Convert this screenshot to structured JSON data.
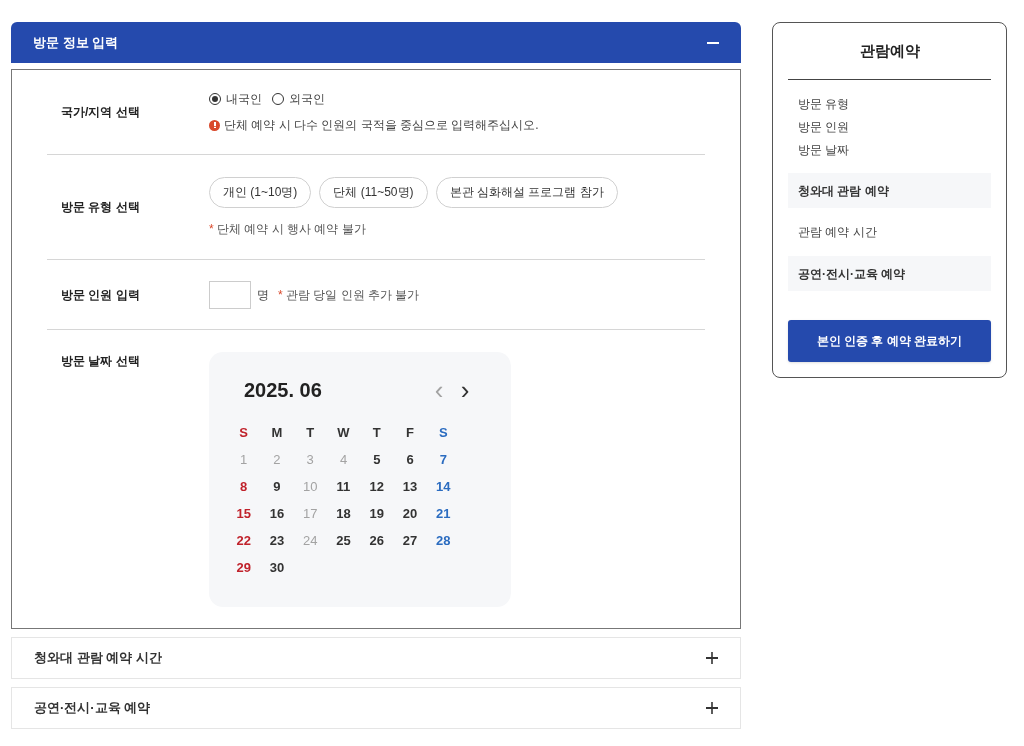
{
  "sections": [
    {
      "title": "방문 정보 입력",
      "expanded": true
    },
    {
      "title": "청와대 관람 예약 시간",
      "expanded": false
    },
    {
      "title": "공연·전시·교육 예약",
      "expanded": false
    }
  ],
  "nationality": {
    "label": "국가/지역 선택",
    "options": [
      {
        "label": "내국인",
        "selected": true
      },
      {
        "label": "외국인",
        "selected": false
      }
    ],
    "notice": "단체 예약 시 다수 인원의 국적을 중심으로 입력해주십시오."
  },
  "visit_type": {
    "label": "방문 유형 선택",
    "options": [
      {
        "label": "개인 (1~10명)",
        "selected": false
      },
      {
        "label": "단체 (11~50명)",
        "selected": false
      },
      {
        "label": "본관 심화해설 프로그램 참가",
        "selected": false
      }
    ],
    "note": "단체 예약 시 행사 예약 불가",
    "note_mark": "*"
  },
  "visitors": {
    "label": "방문 인원 입력",
    "unit": "명",
    "note": "관람 당일 인원 추가 불가",
    "note_mark": "*"
  },
  "date": {
    "label": "방문 날짜 선택",
    "calendar": {
      "month": "2025. 06",
      "prev": {
        "symbol": "‹",
        "disabled": true
      },
      "next": {
        "symbol": "›",
        "disabled": false
      },
      "weekdays": [
        "S",
        "M",
        "T",
        "W",
        "T",
        "F",
        "S"
      ],
      "days": [
        {
          "label": "1",
          "disabled": true
        },
        {
          "label": "2",
          "disabled": true
        },
        {
          "label": "3",
          "disabled": true
        },
        {
          "label": "4",
          "disabled": true
        },
        {
          "label": "5",
          "disabled": false
        },
        {
          "label": "6",
          "disabled": false
        },
        {
          "label": "7",
          "disabled": false
        },
        {
          "label": "8",
          "disabled": false
        },
        {
          "label": "9",
          "disabled": false
        },
        {
          "label": "10",
          "disabled": true
        },
        {
          "label": "11",
          "disabled": false
        },
        {
          "label": "12",
          "disabled": false
        },
        {
          "label": "13",
          "disabled": false
        },
        {
          "label": "14",
          "disabled": false
        },
        {
          "label": "15",
          "disabled": false
        },
        {
          "label": "16",
          "disabled": false
        },
        {
          "label": "17",
          "disabled": true
        },
        {
          "label": "18",
          "disabled": false
        },
        {
          "label": "19",
          "disabled": false
        },
        {
          "label": "20",
          "disabled": false
        },
        {
          "label": "21",
          "disabled": false
        },
        {
          "label": "22",
          "disabled": false
        },
        {
          "label": "23",
          "disabled": false
        },
        {
          "label": "24",
          "disabled": true
        },
        {
          "label": "25",
          "disabled": false
        },
        {
          "label": "26",
          "disabled": false
        },
        {
          "label": "27",
          "disabled": false
        },
        {
          "label": "28",
          "disabled": false
        },
        {
          "label": "29",
          "disabled": false
        },
        {
          "label": "30",
          "disabled": false
        }
      ]
    }
  },
  "summary": {
    "title": "관람예약",
    "items": [
      {
        "kind": "item",
        "label": "방문 유형"
      },
      {
        "kind": "item",
        "label": "방문 인원"
      },
      {
        "kind": "item",
        "label": "방문 날짜"
      },
      {
        "kind": "section",
        "label": "청와대 관람 예약"
      },
      {
        "kind": "item",
        "label": "관람 예약 시간"
      },
      {
        "kind": "section",
        "label": "공연·전시·교육 예약"
      }
    ],
    "button": "본인 인증 후 예약 완료하기"
  }
}
